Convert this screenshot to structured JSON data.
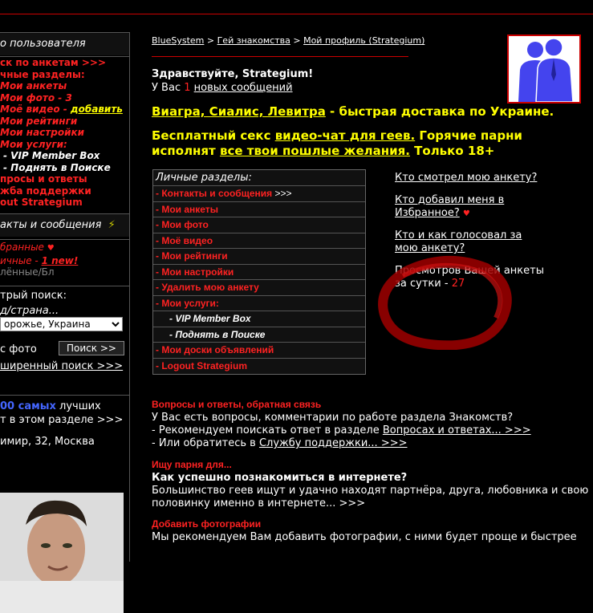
{
  "sidebar": {
    "header": "о пользователя",
    "menu": [
      {
        "text": "ск по анкетам >>>",
        "style": "red-b"
      },
      {
        "text": "чные разделы:",
        "style": "red-b"
      },
      {
        "text": "Мои анкеты",
        "style": "red-it"
      },
      {
        "text": "Мои фото - 3",
        "style": "red-it"
      },
      {
        "text": "Моё видео - ",
        "style": "red-it",
        "extra": "добавить"
      },
      {
        "text": "Мои рейтинги",
        "style": "red-it"
      },
      {
        "text": "Мои настройки",
        "style": "red-it"
      },
      {
        "text": "Мои услуги:",
        "style": "red-it"
      },
      {
        "text": "- VIP Member Box",
        "style": "white-it"
      },
      {
        "text": "- Поднять в Поиске",
        "style": "white-it"
      },
      {
        "text": "просы и ответы",
        "style": "red-b"
      },
      {
        "text": "жба поддержки",
        "style": "red-b"
      },
      {
        "text": "out Strategium",
        "style": "red-b"
      }
    ],
    "contacts_header": "акты и сообщения",
    "contacts": {
      "favorites": "бранные",
      "personal": "ичные - ",
      "personal_new": "1 new!",
      "deleted": "лённые/Бл"
    },
    "search": {
      "label": "трый поиск:",
      "city_label": "д/страна...",
      "city_value": "орожье, Украина",
      "photo_label": "с фото",
      "search_button": "Поиск >>",
      "extended": "ширенный поиск >>>"
    },
    "best": {
      "count": "00 самых",
      "line1_rest": " лучших",
      "line2": "т в этом разделе >>>",
      "profile": "имир, 32, Москва"
    }
  },
  "breadcrumb": {
    "items": [
      "BlueSystem",
      "Гей знакомства",
      "Мой профиль (Strategium)"
    ],
    "separator": " > "
  },
  "greeting": {
    "hello": "Здравствуйте, Strategium!",
    "prefix": "У Вас ",
    "count": "1",
    "link": "новых сообщений"
  },
  "ads": {
    "ad1_link": "Виагра, Сиалис, Левитра",
    "ad1_rest": " - быстрая доставка по Украине.",
    "ad2_part1": "Бесплатный секс ",
    "ad2_link1": "видео-чат для геев.",
    "ad2_part2": " Горячие парни исполнят ",
    "ad2_link2": "все твои пошлые желания.",
    "ad2_part3": " Только 18+"
  },
  "personal_menu": {
    "header": "Личные разделы:",
    "items": [
      {
        "text": "- Контакты и сообщения",
        "suffix": " >>>",
        "kind": "main"
      },
      {
        "text": "- Мои анкеты",
        "kind": "main"
      },
      {
        "text": "- Мои фото",
        "kind": "main"
      },
      {
        "text": "- Моё видео",
        "kind": "main"
      },
      {
        "text": "- Мои рейтинги",
        "kind": "main"
      },
      {
        "text": "- Мои настройки",
        "kind": "main"
      },
      {
        "text": "- Удалить мою анкету",
        "kind": "main"
      },
      {
        "text": "- Мои услуги:",
        "kind": "main"
      },
      {
        "text": "- VIP Member Box",
        "kind": "sub"
      },
      {
        "text": "- Поднять в Поиске",
        "kind": "sub"
      },
      {
        "text": "- Мои доски объявлений",
        "kind": "main"
      },
      {
        "text": "- Logout Strategium",
        "kind": "main"
      }
    ]
  },
  "info_links": {
    "who_viewed": "Кто смотрел мою анкету?",
    "who_added": "Кто добавил меня в Избранное?",
    "who_voted": "Кто и как голосовал за мою анкету?",
    "views_text": "Просмотров Вашей анкеты за сутки - ",
    "views_count": "27"
  },
  "sections": {
    "qa_title": "Вопросы и ответы, обратная связь",
    "qa_line1": "У Вас есть вопросы, комментарии по работе раздела Знакомств?",
    "qa_line2_prefix": "- Рекомендуем поискать ответ в разделе ",
    "qa_line2_link": "Вопросах и ответах... >>>",
    "qa_line3_prefix": "- Или обратитесь в ",
    "qa_line3_link": "Службу поддержки... >>>",
    "find_title": "Ищу парня для...",
    "find_bold": "Как успешно познакомиться в интернете?",
    "find_text1": "Большинство геев ищут и удачно находят партнёра, друга, любовника и свою",
    "find_text2": "половинку именно в интернете... >>>",
    "photo_title": "Добавить фотографии",
    "photo_text": "Мы рекомендуем Вам добавить фотографии, с ними будет проще и быстрее"
  },
  "colors": {
    "accent_red": "#ff2222",
    "link_yellow": "#ffff00",
    "avatar_blue": "#4444ee"
  }
}
